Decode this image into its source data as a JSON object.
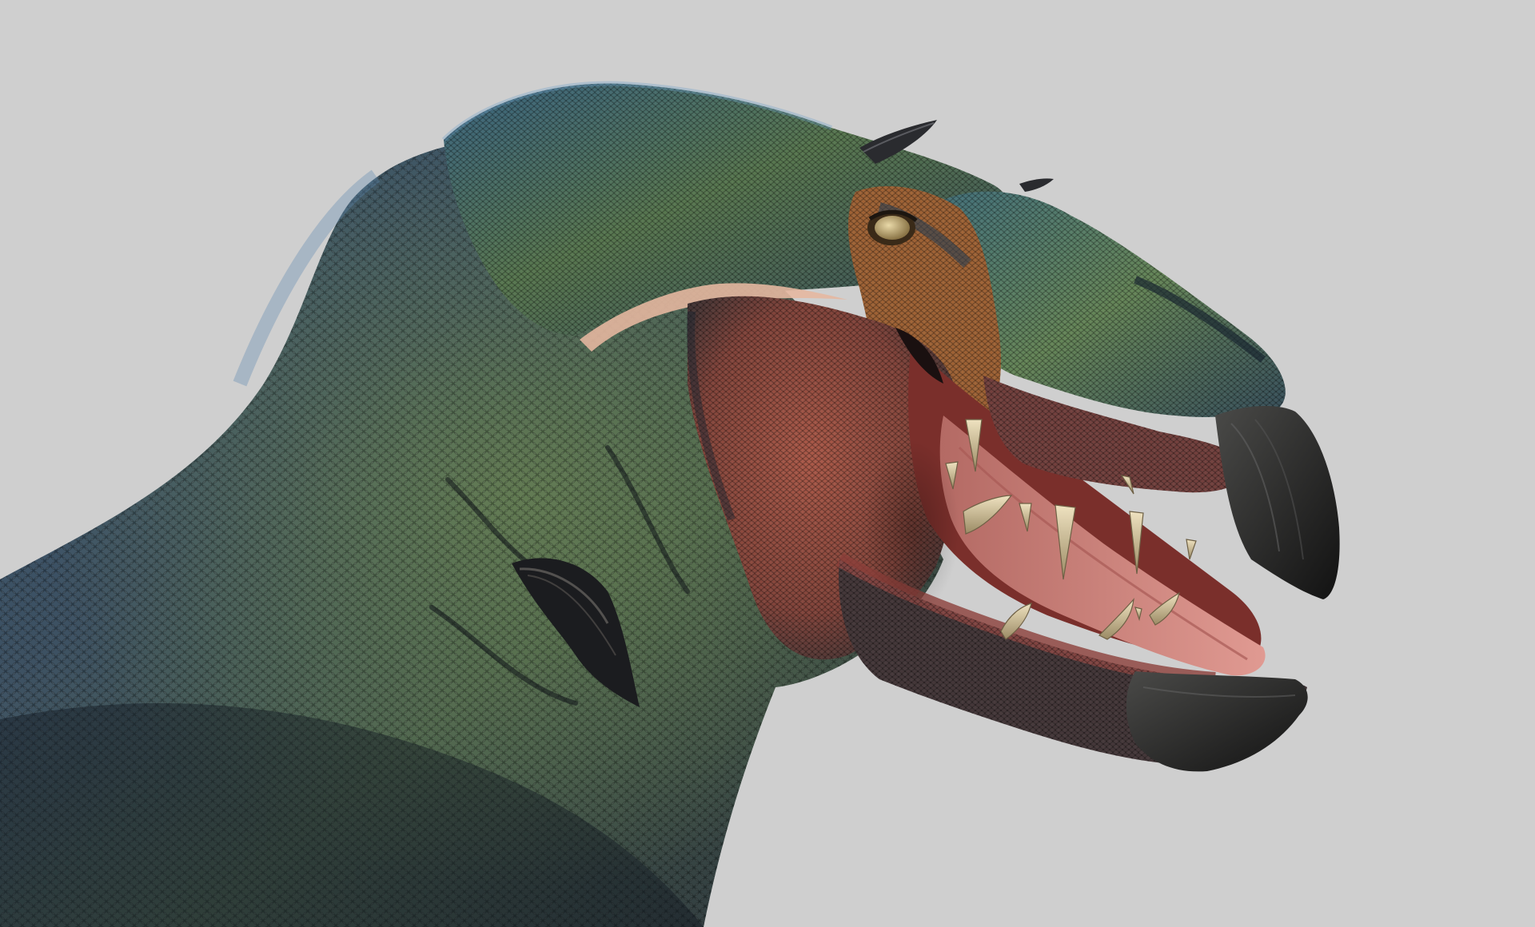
{
  "scene": {
    "subject": "dinosaur-head-sculpt",
    "colors": {
      "background": "#cfcfcf",
      "skin_dark": "#1c2a38",
      "skin_blue": "#2c4a66",
      "skin_green": "#4f6a44",
      "skin_olive": "#6f7e4c",
      "mouth_red": "#8a3d33",
      "mouth_inner": "#c9857a",
      "tongue": "#d98c86",
      "tooth": "#d8c9a3",
      "beak": "#2a2a2a",
      "eye": "#c8b078",
      "eye_ring": "#b86a2a",
      "horn": "#2b2b2e",
      "gum_highlight": "#e7b9a3"
    }
  }
}
